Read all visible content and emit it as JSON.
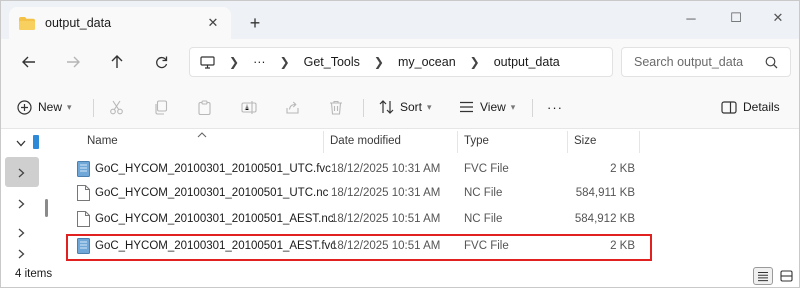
{
  "tab": {
    "title": "output_data",
    "close_glyph": "✕",
    "new_tab_glyph": "+"
  },
  "window_controls": {
    "minimize": "─",
    "maximize": "☐",
    "close": "✕"
  },
  "address": {
    "breadcrumbs": [
      "Get_Tools",
      "my_ocean",
      "output_data"
    ],
    "overflow": "···"
  },
  "search": {
    "placeholder": "Search output_data"
  },
  "toolbar": {
    "new_label": "New",
    "sort_label": "Sort",
    "view_label": "View",
    "more_label": "···",
    "details_label": "Details"
  },
  "columns": {
    "name": "Name",
    "date_modified": "Date modified",
    "type": "Type",
    "size": "Size"
  },
  "files": [
    {
      "name": "GoC_HYCOM_20100301_20100501_UTC.fvc",
      "date": "18/12/2025 10:31 AM",
      "type": "FVC File",
      "size": "2 KB",
      "icon": "fvc-file-icon"
    },
    {
      "name": "GoC_HYCOM_20100301_20100501_UTC.nc",
      "date": "18/12/2025 10:31 AM",
      "type": "NC File",
      "size": "584,911 KB",
      "icon": "generic-file-icon"
    },
    {
      "name": "GoC_HYCOM_20100301_20100501_AEST.nc",
      "date": "18/12/2025 10:51 AM",
      "type": "NC File",
      "size": "584,912 KB",
      "icon": "generic-file-icon"
    },
    {
      "name": "GoC_HYCOM_20100301_20100501_AEST.fvc",
      "date": "18/12/2025 10:51 AM",
      "type": "FVC File",
      "size": "2 KB",
      "icon": "fvc-file-icon"
    }
  ],
  "status": {
    "item_count": "4 items"
  },
  "colors": {
    "highlight": "#e0211f",
    "folder": "#f4c247",
    "fvc_icon": "#6fa8d8"
  }
}
